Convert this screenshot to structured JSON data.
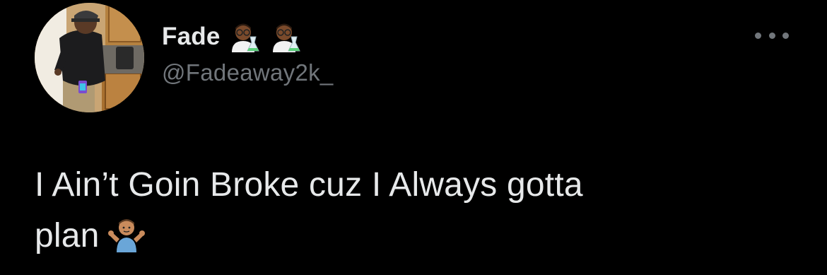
{
  "tweet": {
    "display_name": "Fade",
    "name_emojis": [
      "scientist-emoji",
      "scientist-emoji"
    ],
    "handle": "@Fadeaway2k_",
    "text_line1": "I Ain’t Goin Broke cuz I Always gotta",
    "text_line2": "plan",
    "text_emoji": "person-shrugging-emoji"
  },
  "colors": {
    "background": "#000000",
    "primary_text": "#e7e9ea",
    "secondary_text": "#71767b"
  },
  "icons": {
    "more": "more-horizontal-icon"
  }
}
